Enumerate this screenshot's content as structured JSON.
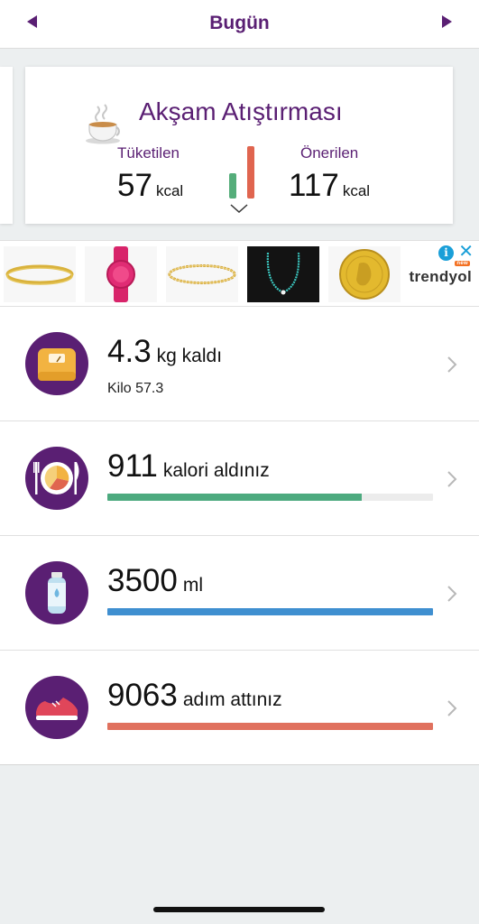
{
  "header": {
    "title": "Bugün",
    "prev_icon": "triangle-left-icon",
    "next_icon": "triangle-right-icon",
    "accent_color": "#5a1f73"
  },
  "meal": {
    "title": "Akşam Atıştırması",
    "icon": "tea-cup-icon",
    "consumed_label": "Tüketilen",
    "consumed_value": "57",
    "consumed_unit": "kcal",
    "recommended_label": "Önerilen",
    "recommended_value": "117",
    "recommended_unit": "kcal",
    "consumed_color": "#55ad7a",
    "recommended_color": "#e0654f"
  },
  "ad": {
    "brand": "trendyol",
    "badge": "new",
    "items": [
      "gold-bangle",
      "pink-watch",
      "twisted-gold-bangle",
      "turquoise-necklace",
      "gold-coin"
    ]
  },
  "trackers": {
    "weight": {
      "value": "4.3",
      "unit": "kg kaldı",
      "sub": "Kilo 57.3",
      "icon": "scale-icon"
    },
    "calories": {
      "value": "911",
      "unit": "kalori aldınız",
      "progress": 0.78,
      "color": "#4daa7f",
      "icon": "plate-icon"
    },
    "water": {
      "value": "3500",
      "unit": "ml",
      "progress": 1.0,
      "color": "#3f8fd0",
      "icon": "water-bottle-icon"
    },
    "steps": {
      "value": "9063",
      "unit": "adım attınız",
      "progress": 1.0,
      "color": "#e0715e",
      "icon": "sneaker-icon"
    }
  }
}
